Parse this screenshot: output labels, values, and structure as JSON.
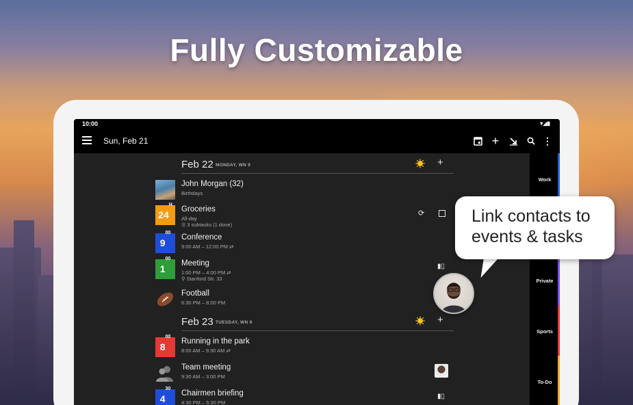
{
  "headline": "Fully Customizable",
  "status_bar": {
    "time": "10:00"
  },
  "app_bar": {
    "date": "Sun, Feb 21"
  },
  "days": [
    {
      "date": "Feb 22",
      "sub": "MONDAY, WN 9"
    },
    {
      "date": "Feb 23",
      "sub": "TUESDAY, WN 9"
    }
  ],
  "events": [
    {
      "title": "John Morgan (32)",
      "line1": "Birthdays",
      "line2": ""
    },
    {
      "title": "Groceries",
      "line1": "All-day",
      "line2": "3 subtasks (1 done)",
      "thumb_big": "24",
      "thumb_small": "H"
    },
    {
      "title": "Conference",
      "line1": "9:00 AM – 12:00 PM",
      "line2": "",
      "thumb_big": "9",
      "thumb_small": "00"
    },
    {
      "title": "Meeting",
      "line1": "1:00 PM – 4:00 PM",
      "line2": "Stanford Str. 33",
      "thumb_big": "1",
      "thumb_small": "00"
    },
    {
      "title": "Football",
      "line1": "6:30 PM – 8:00 PM",
      "line2": ""
    },
    {
      "title": "Running in the park",
      "line1": "8:00 AM – 9:30 AM",
      "line2": "",
      "thumb_big": "8",
      "thumb_small": "00"
    },
    {
      "title": "Team meeting",
      "line1": "9:30 AM – 3:00 PM",
      "line2": ""
    },
    {
      "title": "Chairmen briefing",
      "line1": "4:30 PM – 5:30 PM",
      "line2": "",
      "thumb_big": "4",
      "thumb_small": "30"
    }
  ],
  "side_tabs": [
    {
      "label": "Work",
      "color": "#1e62d6"
    },
    {
      "label": "Private",
      "color": "#7c4dff"
    },
    {
      "label": "Sports",
      "color": "#e53935"
    },
    {
      "label": "To-Do",
      "color": "#f9a825"
    }
  ],
  "callout": {
    "line1": "Link contacts to",
    "line2": "events & tasks"
  },
  "colors": {
    "groceries": "#f39c12",
    "conference": "#1e4ed8",
    "meeting": "#2e9d3a",
    "running": "#e53935",
    "chairmen": "#1e4ed8",
    "sun": "#f4c21c"
  }
}
